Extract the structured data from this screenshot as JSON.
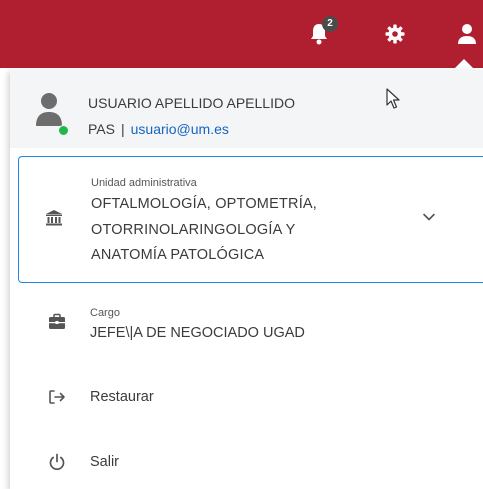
{
  "header": {
    "notifications_count": "2",
    "colors": {
      "bar": "#b01f30",
      "icon": "#ffffff",
      "badge": "#4b4b4b"
    },
    "icons": [
      "bell-icon",
      "gear-icon",
      "user-icon"
    ]
  },
  "profile": {
    "name": "USUARIO APELLIDO APELLIDO",
    "role": "PAS",
    "separator": "|",
    "email": "usuario@um.es",
    "status_color": "#1eb94a",
    "avatar_icon": "user-avatar-icon"
  },
  "unidad": {
    "caption": "Unidad administrativa",
    "lines": [
      "OFTALMOLOGÍA, OPTOMETRÍA,",
      "OTORRINOLARINGOLOGÍA Y",
      "ANATOMÍA PATOLÓGICA"
    ],
    "icon": "bank-icon",
    "accent_color": "#1e88e5"
  },
  "cargo": {
    "caption": "Cargo",
    "value": "JEFE\\|A DE NEGOCIADO UGAD",
    "icon": "briefcase-icon"
  },
  "menu": {
    "restaurar": {
      "label": "Restaurar",
      "icon": "sign-out-arrow-icon"
    },
    "salir": {
      "label": "Salir",
      "icon": "power-icon"
    }
  }
}
